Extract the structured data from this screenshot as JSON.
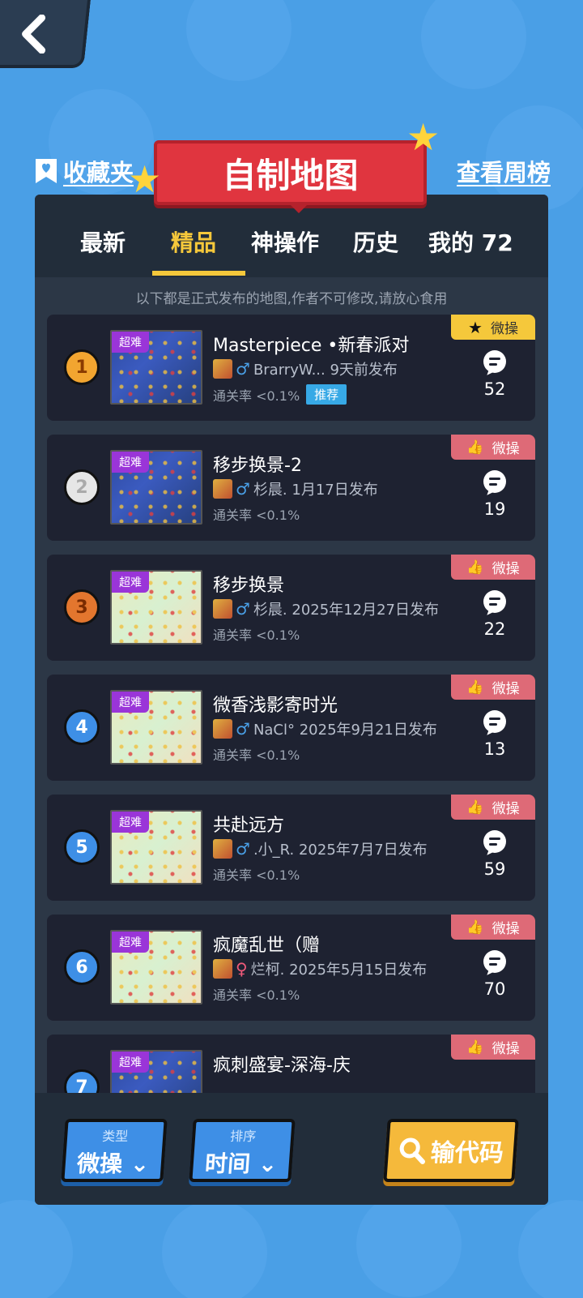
{
  "header": {
    "favorites_label": "收藏夹",
    "title": "自制地图",
    "week_rank_label": "查看周榜"
  },
  "tabs": [
    {
      "label": "最新"
    },
    {
      "label": "精品"
    },
    {
      "label": "神操作"
    },
    {
      "label": "历史"
    },
    {
      "label": "我的 72"
    }
  ],
  "active_tab": "精品",
  "notice": "以下都是正式发布的地图,作者不可修改,请放心食用",
  "maps": [
    {
      "rank": "1",
      "difficulty": "超难",
      "title": "Masterpiece •新春派对",
      "gender": "♂",
      "author": "BrarryW... 9天前发布",
      "pass_rate": "通关率 <0.1%",
      "badge": "推荐",
      "tag": "微操",
      "comments": "52"
    },
    {
      "rank": "2",
      "difficulty": "超难",
      "title": "移步换景-2",
      "gender": "♂",
      "author": "杉晨. 1月17日发布",
      "pass_rate": "通关率 <0.1%",
      "tag": "微操",
      "comments": "19"
    },
    {
      "rank": "3",
      "difficulty": "超难",
      "title": "移步换景",
      "gender": "♂",
      "author": "杉晨. 2025年12月27日发布",
      "pass_rate": "通关率 <0.1%",
      "tag": "微操",
      "comments": "22"
    },
    {
      "rank": "4",
      "difficulty": "超难",
      "title": "微香浅影寄时光",
      "gender": "♂",
      "author": "NaCl° 2025年9月21日发布",
      "pass_rate": "通关率 <0.1%",
      "tag": "微操",
      "comments": "13"
    },
    {
      "rank": "5",
      "difficulty": "超难",
      "title": "共赴远方",
      "gender": "♂",
      "author": ".小_R. 2025年7月7日发布",
      "pass_rate": "通关率 <0.1%",
      "tag": "微操",
      "comments": "59"
    },
    {
      "rank": "6",
      "difficulty": "超难",
      "title": "疯魔乱世（赠",
      "gender": "♀",
      "author": "烂柯. 2025年5月15日发布",
      "pass_rate": "通关率 <0.1%",
      "tag": "微操",
      "comments": "70"
    },
    {
      "rank": "7",
      "difficulty": "超难",
      "title": "疯刺盛宴-深海-庆",
      "tag": "微操"
    }
  ],
  "bottom": {
    "type_label": "类型",
    "type_value": "微操",
    "sort_label": "排序",
    "sort_value": "时间",
    "code_button": "输代码"
  },
  "colors": {
    "background": "#4a9fe6",
    "panel": "#2c3746",
    "accent_yellow": "#f5c83b",
    "banner_red": "#e0353f",
    "tag_red": "#de6a77",
    "difficulty_purple": "#9a35d8"
  },
  "icons": {
    "back": "back-arrow-icon",
    "favorites": "bookmark-heart-icon",
    "comment": "comment-bubble-icon",
    "thumb": "thumbs-up-icon",
    "star": "star-icon",
    "search": "search-icon",
    "dropdown": "chevron-down-icon"
  }
}
